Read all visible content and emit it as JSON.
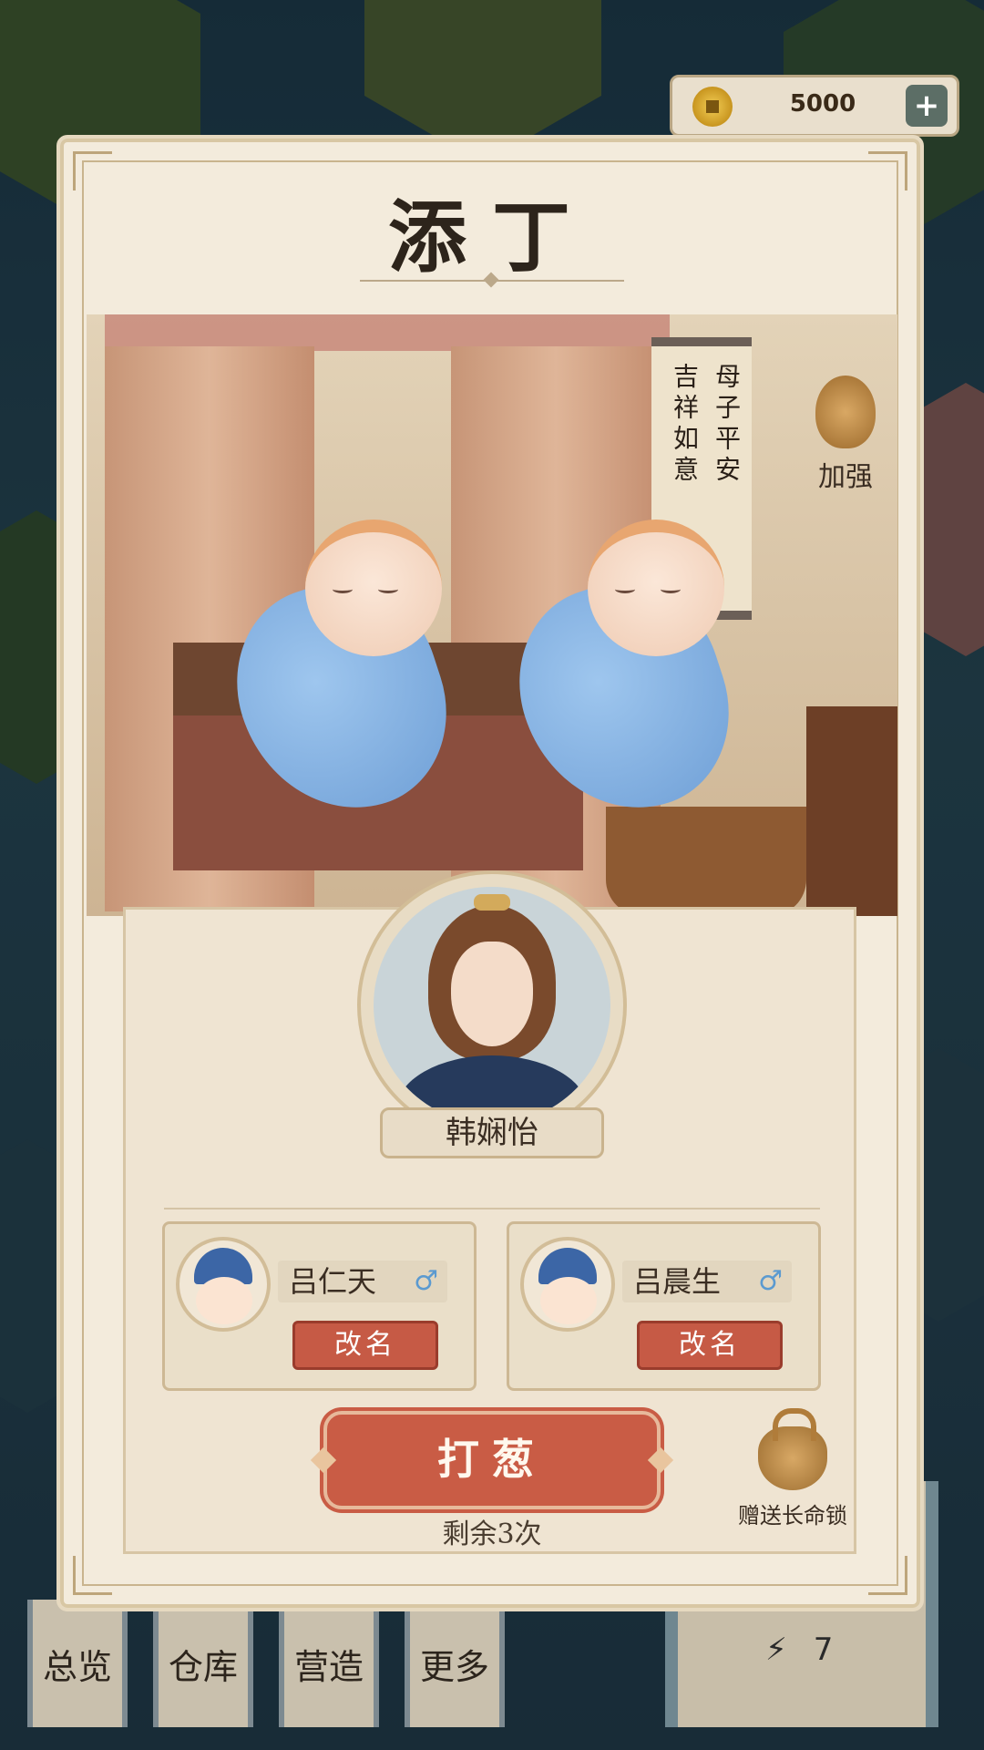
{
  "hud": {
    "coins": "5000",
    "energy": "7"
  },
  "bottom_nav": [
    "总览",
    "仓库",
    "营造",
    "更多"
  ],
  "dialog": {
    "title": "添丁",
    "scroll_left": "吉祥如意",
    "scroll_right": "母子平安",
    "boost_label": "加强",
    "mother_name": "韩娴怡",
    "children": [
      {
        "name": "吕仁天",
        "gender": "♂",
        "rename_label": "改名"
      },
      {
        "name": "吕晨生",
        "gender": "♂",
        "rename_label": "改名"
      }
    ],
    "action_label": "打葱",
    "remaining": "剩余3次",
    "gift_label": "赠送长命锁"
  },
  "colors": {
    "accent_red": "#c95c45",
    "card_bg": "#f3ebdc",
    "male_blue": "#5b9ad0"
  }
}
